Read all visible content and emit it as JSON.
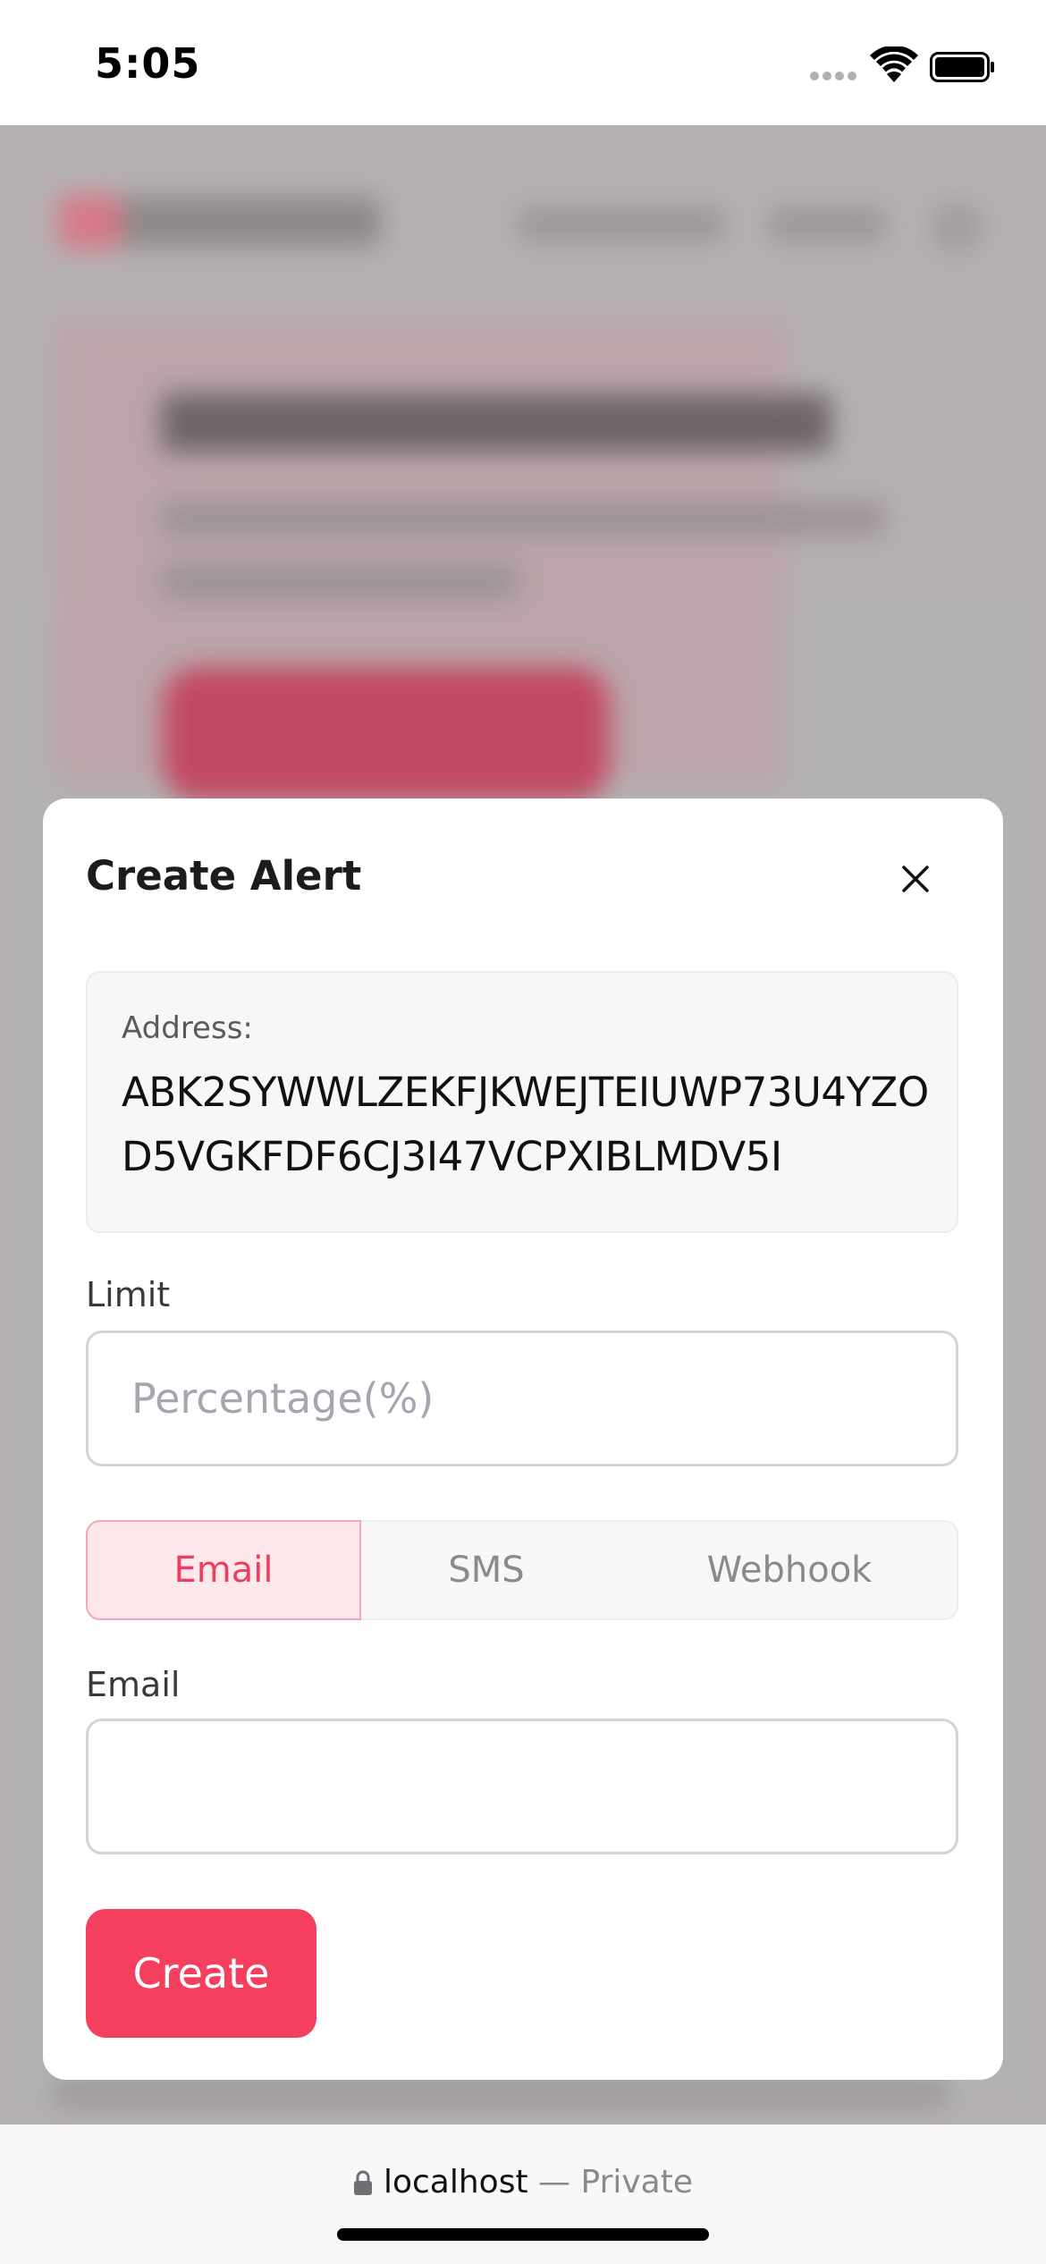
{
  "status_bar": {
    "time": "5:05"
  },
  "modal": {
    "title": "Create Alert",
    "address_label": "Address:",
    "address_value": "ABK2SYWWLZEKFJKWEJTEIUWP73U4YZOD5VGKFDF6CJ3I47VCPXIBLMDV5I",
    "limit_label": "Limit",
    "limit_placeholder": "Percentage(%)",
    "limit_value": "",
    "tabs": [
      {
        "label": "Email",
        "selected": true
      },
      {
        "label": "SMS",
        "selected": false
      },
      {
        "label": "Webhook",
        "selected": false
      }
    ],
    "email_label": "Email",
    "email_value": "",
    "create_label": "Create"
  },
  "browser": {
    "host": "localhost",
    "mode": "— Private"
  },
  "colors": {
    "accent": "#f43f5e",
    "tab_selected_bg": "#fde8ec",
    "tab_selected_text": "#ee3d5e"
  },
  "icons": {
    "close": "close-icon",
    "lock": "lock-icon",
    "wifi": "wifi-icon",
    "battery": "battery-icon",
    "signal": "signal-icon"
  }
}
